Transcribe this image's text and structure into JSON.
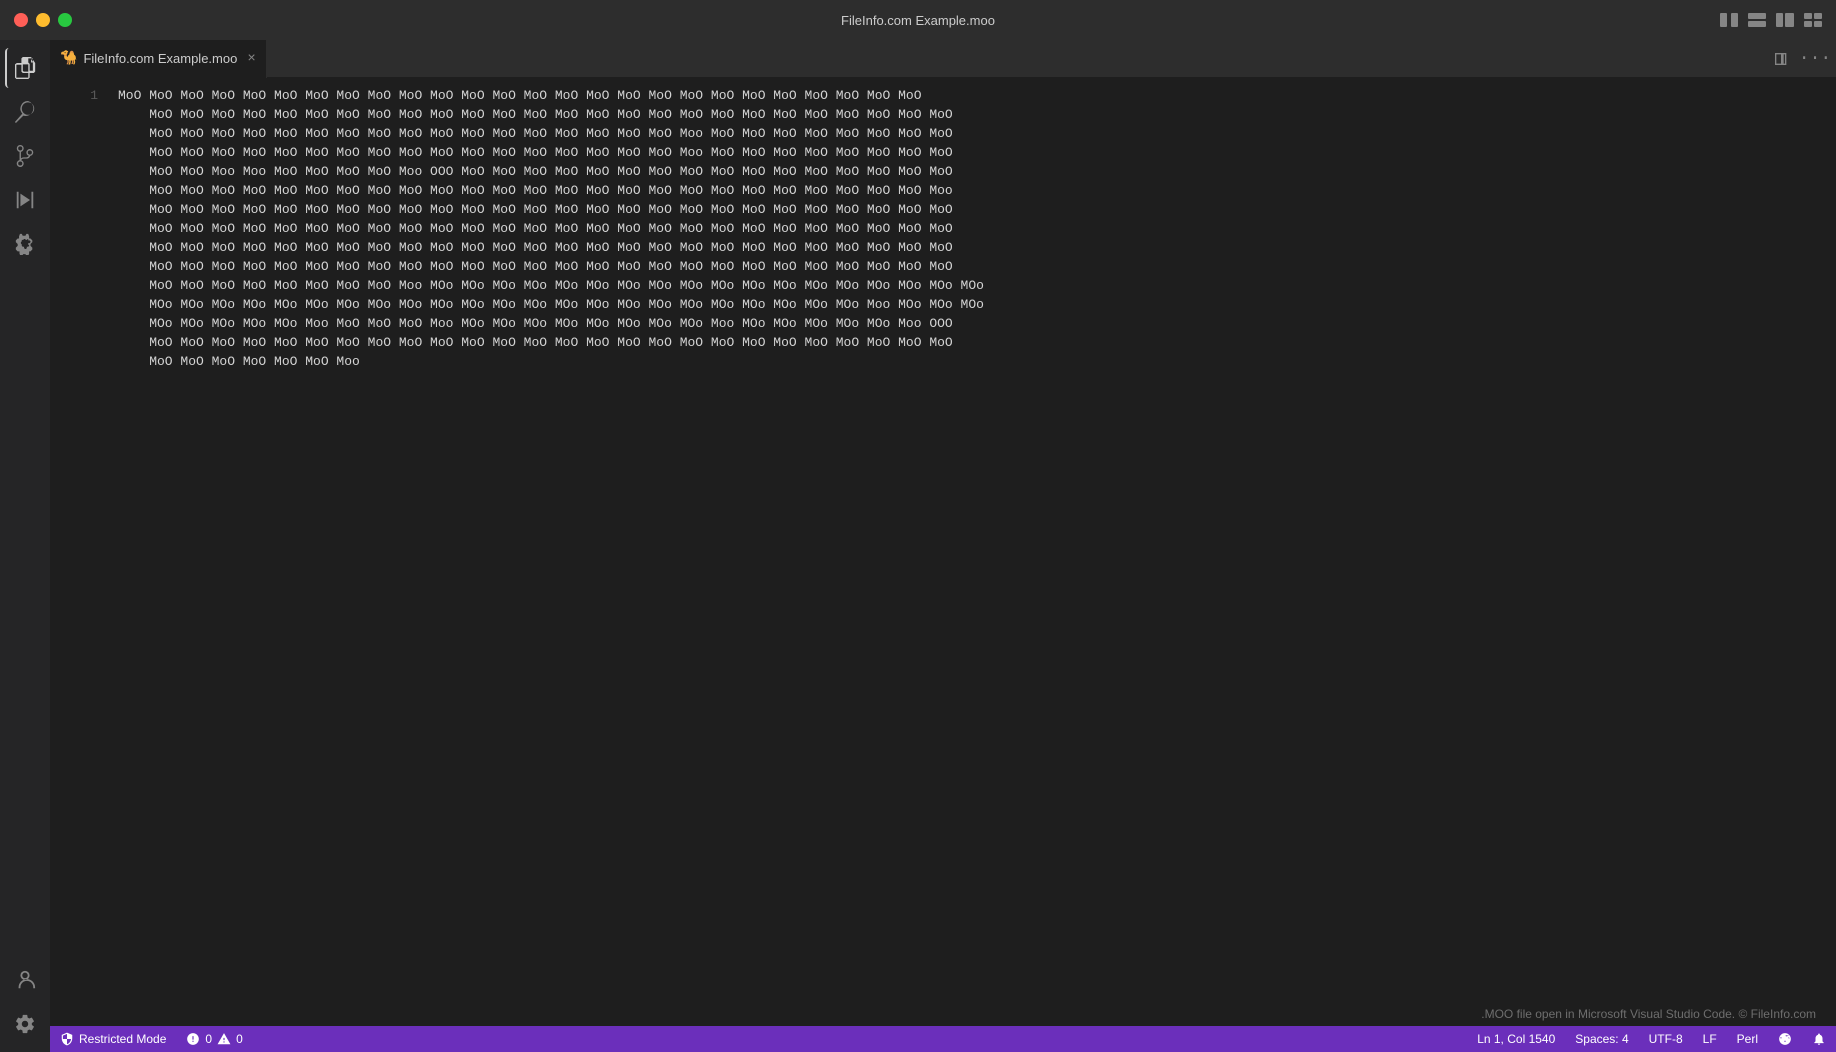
{
  "window": {
    "title": "FileInfo.com Example.moo"
  },
  "titlebar": {
    "traffic_lights": [
      "close",
      "minimize",
      "maximize"
    ],
    "right_icons": [
      "split-editor",
      "layout",
      "split-vertical",
      "more"
    ]
  },
  "activity_bar": {
    "items": [
      {
        "name": "explorer",
        "icon": "⎘",
        "active": true
      },
      {
        "name": "search",
        "icon": "🔍"
      },
      {
        "name": "source-control",
        "icon": "⌥"
      },
      {
        "name": "run",
        "icon": "▷"
      },
      {
        "name": "extensions",
        "icon": "⊞"
      }
    ],
    "bottom_items": [
      {
        "name": "account",
        "icon": "👤"
      },
      {
        "name": "settings",
        "icon": "⚙"
      }
    ]
  },
  "tabs": [
    {
      "label": "FileInfo.com Example.moo",
      "icon": "🐪",
      "active": true,
      "close_label": "×"
    }
  ],
  "tab_bar_actions": {
    "split": "⊡",
    "more": "…"
  },
  "editor": {
    "line_number": "1",
    "content": "MoO MoO MoO MoO MoO MoO MoO MoO MoO MoO MoO MoO MoO MoO MoO MoO MoO MoO MoO MoO MoO MoO MoO MoO MoO MoO\n    MoO MoO MoO MoO MoO MoO MoO MoO MoO MoO MoO MoO MoO MoO MoO MoO MoO MoO MoO MoO MoO MoO MoO MoO MoO MoO\n    MoO MoO MoO MoO MoO MoO MoO MoO MoO MoO MoO MoO MoO MoO MoO MoO MoO Moo MoO MoO MoO MoO MoO MoO MoO MoO\n    MoO MoO MoO MoO MoO MoO MoO MoO MoO MoO MoO MoO MoO MoO MoO MoO MoO Moo MoO MoO MoO MoO MoO MoO MoO MoO\n    MoO MoO Moo Moo MoO MoO MoO MoO Moo OOO MoO MoO MoO MoO MoO MoO MoO MoO MoO MoO MoO MoO MoO MoO MoO MoO\n    MoO MoO MoO MoO MoO MoO MoO MoO MoO MoO MoO MoO MoO MoO MoO MoO MoO MoO MoO MoO MoO MoO MoO MoO MoO Moo\n    MoO MoO MoO MoO MoO MoO MoO MoO MoO MoO MoO MoO MoO MoO MoO MoO MoO MoO MoO MoO MoO MoO MoO MoO MoO MoO\n    MoO MoO MoO MoO MoO MoO MoO MoO MoO MoO MoO MoO MoO MoO MoO MoO MoO MoO MoO MoO MoO MoO MoO MoO MoO MoO\n    MoO MoO MoO MoO MoO MoO MoO MoO MoO MoO MoO MoO MoO MoO MoO MoO MoO MoO MoO MoO MoO MoO MoO MoO MoO MoO\n    MoO MoO MoO MoO MoO MoO MoO MoO MoO MoO MoO MoO MoO MoO MoO MoO MoO MoO MoO MoO MoO MoO MoO MoO MoO MoO\n    MoO MoO MoO MoO MoO MoO MoO MoO Moo MOo MOo MOo MOo MOo MOo MOo MOo MOo MOo MOo MOo MOo MOo MOo MOo MOo MOo\n    MOo MOo MOo MOo MOo MOo MOo MOo MOo MOo MOo MOo MOo MOo MOo MOo MOo MOo MOo MOo MOo MOo MOo Moo MOo MOo MOo\n    MOo MOo MOo MOo MOo Moo MoO MoO MoO Moo MOo MOo MOo MOo MOo MOo MOo MOo Moo MOo MOo MOo MOo MOo Moo OOO\n    MoO MoO MoO MoO MoO MoO MoO MoO MoO MoO MoO MoO MoO MoO MoO MoO MoO MoO MoO MoO MoO MoO MoO MoO MoO MoO\n    MoO MoO MoO MoO MoO MoO Moo"
  },
  "info_bar": {
    "text": ".MOO file open in Microsoft Visual Studio Code. © FileInfo.com"
  },
  "status_bar": {
    "restricted_mode": {
      "icon": "shield",
      "label": "Restricted Mode"
    },
    "errors": {
      "icon": "circle-x",
      "count": "0"
    },
    "warnings": {
      "icon": "triangle",
      "count": "0"
    },
    "position": "Ln 1, Col 1540",
    "spaces": "Spaces: 4",
    "encoding": "UTF-8",
    "line_ending": "LF",
    "language": "Perl",
    "remote_icon": "remote",
    "bell_icon": "bell"
  }
}
